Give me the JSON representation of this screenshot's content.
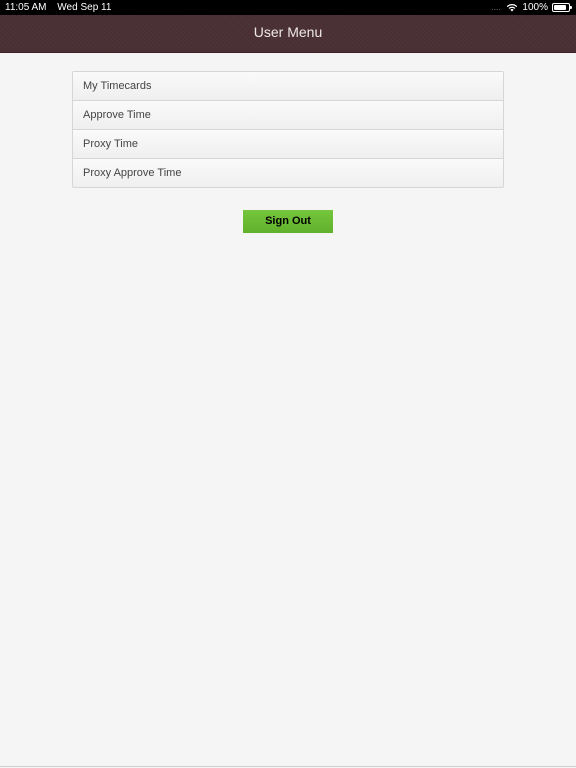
{
  "status_bar": {
    "time": "11:05 AM",
    "date": "Wed Sep 11",
    "signal": "....",
    "battery_percent": "100%",
    "battery_level": 1.0,
    "icons": [
      "wifi-icon",
      "battery-icon"
    ]
  },
  "nav": {
    "title": "User Menu",
    "color": "#4a3034"
  },
  "menu": {
    "items": [
      {
        "label": "My Timecards"
      },
      {
        "label": "Approve Time"
      },
      {
        "label": "Proxy Time"
      },
      {
        "label": "Proxy Approve Time"
      }
    ]
  },
  "actions": {
    "sign_out_label": "Sign Out",
    "sign_out_color": "#6cbe35"
  }
}
